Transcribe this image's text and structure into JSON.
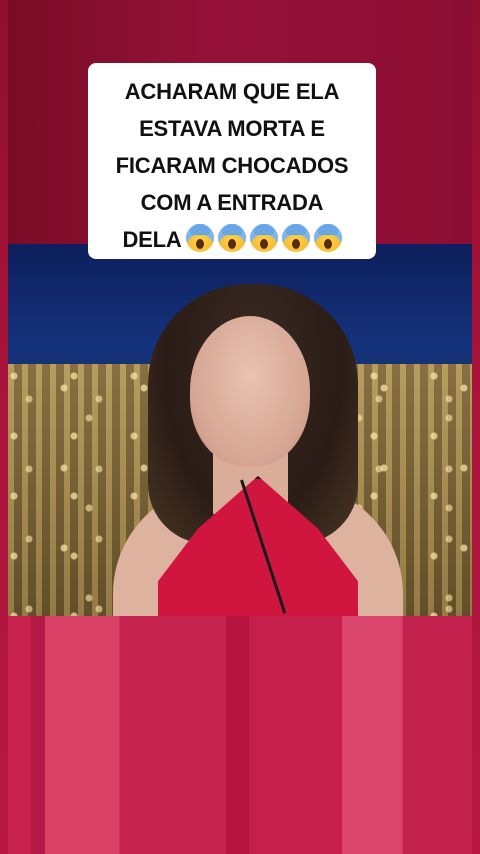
{
  "caption": {
    "lines": [
      "ACHARAM QUE ELA",
      "ESTAVA MORTA E",
      "FICARAM CHOCADOS",
      "COM A ENTRADA",
      "DELA"
    ],
    "emoji_icon": "face-screaming-in-fear-icon",
    "emoji_count": 5
  },
  "colors": {
    "frame": "#a8143a",
    "dress": "#d0163f",
    "caption_bg": "#ffffff"
  }
}
